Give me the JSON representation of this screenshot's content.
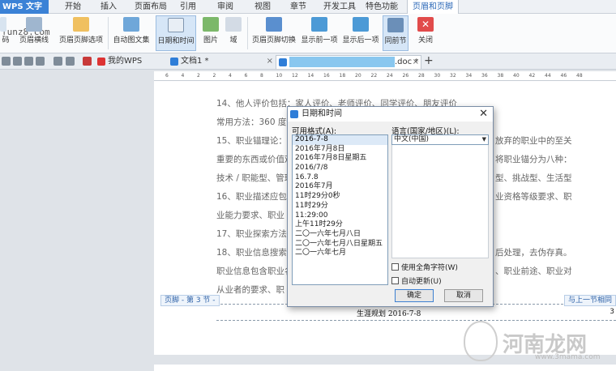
{
  "app": {
    "name": "WPS 文字",
    "watermark_top": "funz8.com"
  },
  "menu": {
    "tabs": [
      "开始",
      "插入",
      "页面布局",
      "引用",
      "审阅",
      "视图",
      "章节",
      "开发工具",
      "特色功能",
      "页眉和页脚"
    ]
  },
  "ribbon": {
    "buttons": [
      "码",
      "页眉横线",
      "页眉页脚选项",
      "自动图文集",
      "日期和时间",
      "图片",
      "域",
      "页眉页脚切换",
      "显示前一项",
      "显示后一项",
      "同前节",
      "关闭"
    ]
  },
  "tabs": {
    "mywps": "我的WPS",
    "doc1": "文档1 *",
    "doc2_suffix": ".doc *"
  },
  "ruler": {
    "numbers": [
      "6",
      "4",
      "2",
      "2",
      "4",
      "6",
      "8",
      "10",
      "12",
      "14",
      "16",
      "18",
      "20",
      "22",
      "24",
      "26",
      "28",
      "30",
      "32",
      "34",
      "36",
      "38",
      "40",
      "42",
      "44",
      "46",
      "48"
    ]
  },
  "document": {
    "lines": [
      "14、他人评价包括：家人评价、老师评价、同学评价、朋友评价",
      "常用方法：360 度评",
      "15、职业锚理论：职",
      "重要的东西或价值观",
      "技术 / 职能型、管理",
      "16、职业描述应包括",
      "业能力要求、职业",
      "17、职业探索方法",
      "18、职业信息搜索和",
      "职业信息包含职业名",
      "从业者的要求、职"
    ],
    "right_fragments": [
      "放弃的职业中的至关",
      "将职业锚分为八种：",
      "型、挑战型、生活型",
      "业资格等级要求、职",
      "后处理，去伪存真。",
      "、职业前途、职业对"
    ],
    "footer_label": "页脚 - 第 3 节 -",
    "footer_same": "与上一节相同",
    "footer_text": "生涯规划 2016-7-8",
    "footer_page": "3"
  },
  "watermark": {
    "brand": "河南龙网",
    "url": "www.3mama.com"
  },
  "dialog": {
    "title": "日期和时间",
    "formats_label": "可用格式(A):",
    "language_label": "语言(国家/地区)(L):",
    "language_value": "中文(中国)",
    "formats": [
      "2016-7-8",
      "2016年7月8日",
      "2016年7月8日星期五",
      "2016/7/8",
      "16.7.8",
      "2016年7月",
      "11时29分0秒",
      "11时29分",
      "11:29:00",
      "上午11时29分",
      "二〇一六年七月八日",
      "二〇一六年七月八日星期五",
      "二〇一六年七月"
    ],
    "fullwidth_label": "使用全角字符(W)",
    "autoupdate_label": "自动更新(U)",
    "ok": "确定",
    "cancel": "取消",
    "close": "✕"
  }
}
